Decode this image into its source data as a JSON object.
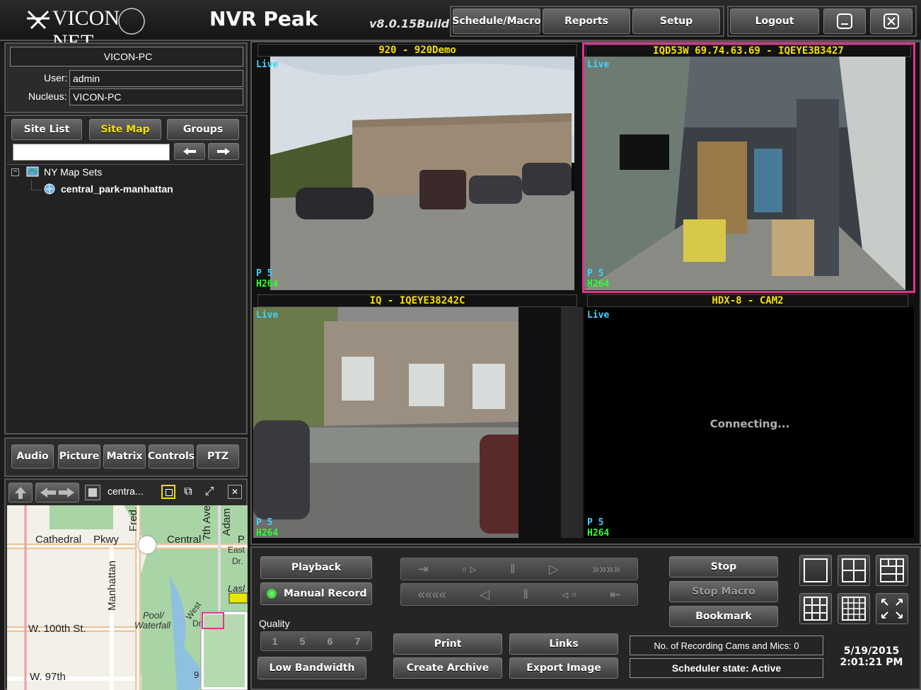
{
  "header": {
    "logo": "VICON NET",
    "app_name": "NVR Peak",
    "version": "v8.0.15Build",
    "menu": [
      "Schedule/Macro",
      "Reports",
      "Setup"
    ],
    "logout": "Logout"
  },
  "server": {
    "name": "VICON-PC",
    "user_label": "User:",
    "user_value": "admin",
    "nucleus_label": "Nucleus:",
    "nucleus_value": "VICON-PC"
  },
  "site_tabs": [
    "Site List",
    "Site Map",
    "Groups"
  ],
  "site_search": {
    "value": ""
  },
  "tree": {
    "root": "NY Map Sets",
    "child": "central_park-manhattan"
  },
  "bottom_tabs": [
    "Audio",
    "Picture",
    "Matrix",
    "Controls",
    "PTZ"
  ],
  "map_toolbar": {
    "map_name": "centra..."
  },
  "map": {
    "labels": [
      "Cathedral",
      "Pkwy",
      "Central",
      "Fred.",
      "7th Ave",
      "Adam",
      "P",
      "East",
      "Dr.",
      "Manhattan",
      "Pool/",
      "Waterfall",
      "West",
      "Dr.",
      "W. 100th St.",
      "W. 97th",
      "9",
      "Lasl"
    ]
  },
  "cameras": [
    {
      "title": "920  -  920Demo",
      "live": "Live",
      "p": "P  5",
      "codec": "H264",
      "status": ""
    },
    {
      "title": "IQD53W 69.74.63.69  -  IQEYE3B3427",
      "live": "Live",
      "p": "P  5",
      "codec": "H264",
      "status": ""
    },
    {
      "title": "IQ  -  IQEYE38242C",
      "live": "Live",
      "p": "P  5",
      "codec": "H264",
      "status": ""
    },
    {
      "title": "HDX-8  -  CAM2",
      "live": "Live",
      "p": "P  5",
      "codec": "H264",
      "status": "Connecting..."
    }
  ],
  "controls": {
    "playback": "Playback",
    "manual_record": "Manual Record",
    "quality_label": "Quality",
    "quality_values": [
      "1",
      "5",
      "6",
      "7"
    ],
    "low_bandwidth": "Low Bandwidth",
    "print": "Print",
    "links": "Links",
    "create_archive": "Create Archive",
    "export_image": "Export Image",
    "stop": "Stop",
    "stop_macro": "Stop Macro",
    "bookmark": "Bookmark",
    "recording_cams": "No. of Recording Cams and Mics: 0",
    "scheduler_state": "Scheduler state: Active",
    "date": "5/19/2015",
    "time": "2:01:21 PM"
  },
  "colors": {
    "accent_yellow": "#f5e000",
    "live_cyan": "#3fd4ff",
    "overlay_green": "#2dff2d",
    "selected_border": "#e0338a"
  }
}
